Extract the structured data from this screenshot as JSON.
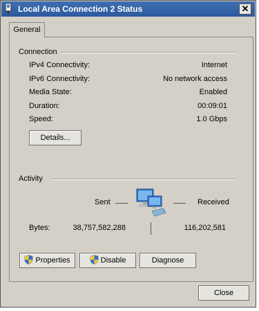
{
  "window": {
    "title": "Local Area Connection 2 Status",
    "close_glyph": "✕"
  },
  "tabs": [
    {
      "label": "General"
    }
  ],
  "connection": {
    "heading": "Connection",
    "rows": [
      {
        "label": "IPv4 Connectivity:",
        "value": "Internet"
      },
      {
        "label": "IPv6 Connectivity:",
        "value": "No network access"
      },
      {
        "label": "Media State:",
        "value": "Enabled"
      },
      {
        "label": "Duration:",
        "value": "00:09:01"
      },
      {
        "label": "Speed:",
        "value": "1.0 Gbps"
      }
    ],
    "details_label": "Details..."
  },
  "activity": {
    "heading": "Activity",
    "sent_label": "Sent",
    "received_label": "Received",
    "bytes_label": "Bytes:",
    "bytes_sent": "38,757,582,288",
    "bytes_received": "116,202,581"
  },
  "actions": {
    "properties_label": "Properties",
    "disable_label": "Disable",
    "diagnose_label": "Diagnose"
  },
  "footer": {
    "close_label": "Close"
  },
  "icons": {
    "title": "network-adapter-icon",
    "activity": "network-computers-icon",
    "uac": "uac-shield-icon"
  }
}
